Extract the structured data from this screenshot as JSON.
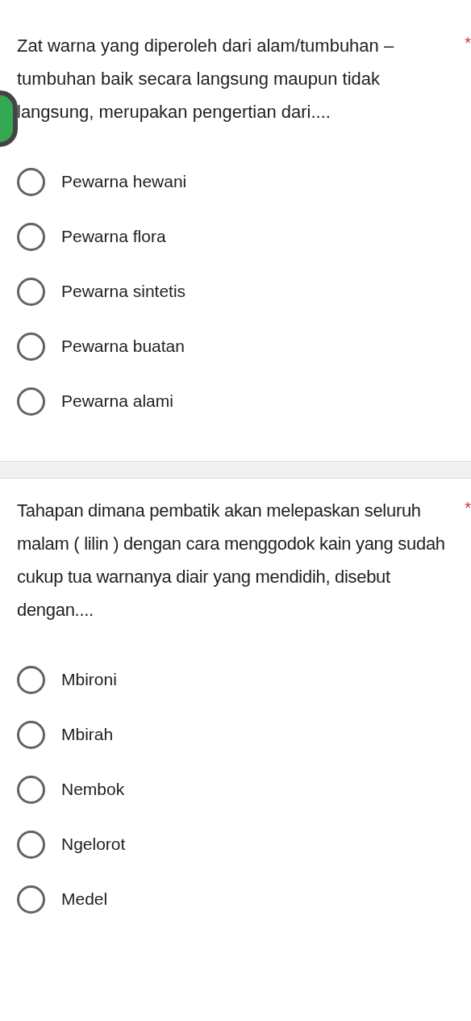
{
  "questions": [
    {
      "text": "Zat warna yang diperoleh dari alam/tumbuhan – tumbuhan baik secara langsung maupun tidak langsung, merupakan pengertian dari....",
      "required_mark": "*",
      "options": [
        {
          "label": "Pewarna hewani",
          "selected": false
        },
        {
          "label": "Pewarna flora",
          "selected": false
        },
        {
          "label": "Pewarna sintetis",
          "selected": false
        },
        {
          "label": "Pewarna buatan",
          "selected": false
        },
        {
          "label": "Pewarna alami",
          "selected": false
        }
      ]
    },
    {
      "text": "Tahapan dimana pembatik akan melepaskan seluruh malam ( lilin ) dengan cara menggodok kain yang sudah cukup tua warnanya diair yang mendidih, disebut dengan....",
      "required_mark": "*",
      "options": [
        {
          "label": "Mbironi",
          "selected": false
        },
        {
          "label": "Mbirah",
          "selected": false
        },
        {
          "label": "Nembok",
          "selected": false
        },
        {
          "label": "Ngelorot",
          "selected": false
        },
        {
          "label": "Medel",
          "selected": false
        }
      ]
    }
  ]
}
